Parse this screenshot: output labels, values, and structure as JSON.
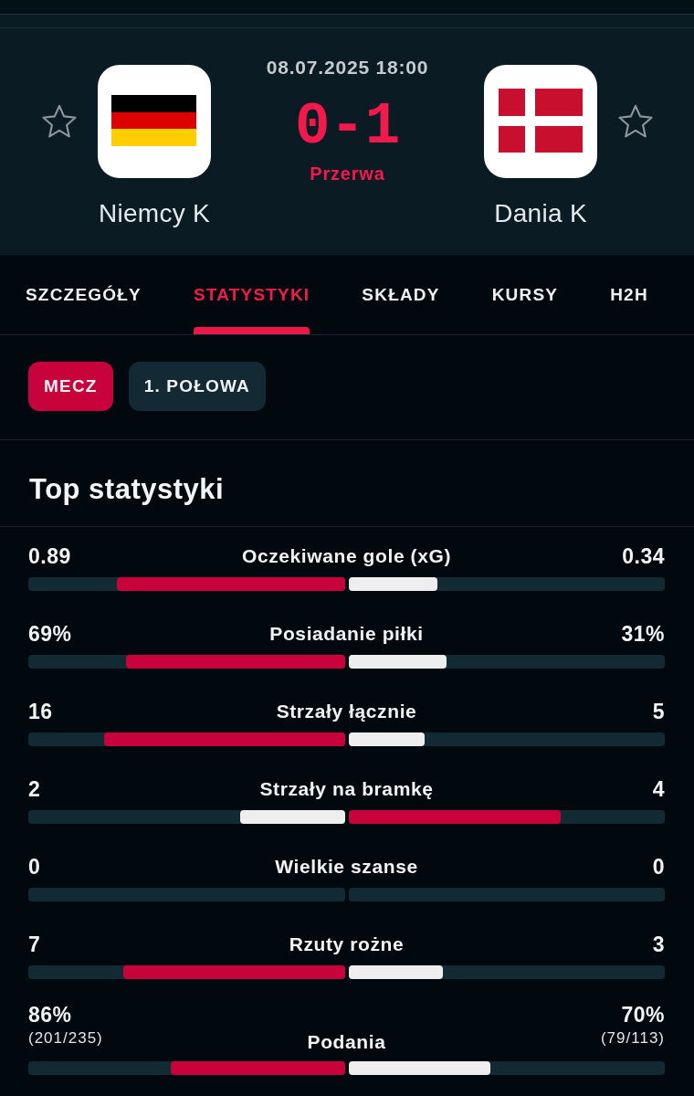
{
  "match": {
    "datetime": "08.07.2025 18:00",
    "score": "0-1",
    "status": "Przerwa",
    "teams": [
      {
        "name": "Niemcy K",
        "kind": "tricolor",
        "favorite": false
      },
      {
        "name": "Dania K",
        "kind": "cross",
        "favorite": false
      }
    ]
  },
  "tabs": [
    {
      "label": "SZCZEGÓŁY",
      "selected": false
    },
    {
      "label": "STATYSTYKI",
      "selected": true
    },
    {
      "label": "SKŁADY",
      "selected": false
    },
    {
      "label": "KURSY",
      "selected": false
    },
    {
      "label": "H2H",
      "selected": false
    }
  ],
  "periods": [
    {
      "label": "MECZ",
      "selected": true
    },
    {
      "label": "1. POŁOWA",
      "selected": false
    }
  ],
  "section": {
    "title": "Top statystyki"
  },
  "stats": [
    {
      "label": "Oczekiwane gole (xG)",
      "home": {
        "value": "0.89",
        "level": 0.72,
        "leading": true
      },
      "away": {
        "value": "0.34",
        "level": 0.28,
        "leading": false
      }
    },
    {
      "label": "Posiadanie piłki",
      "home": {
        "value": "69%",
        "level": 0.69,
        "leading": true
      },
      "away": {
        "value": "31%",
        "level": 0.31,
        "leading": false
      }
    },
    {
      "label": "Strzały łącznie",
      "home": {
        "value": "16",
        "level": 0.76,
        "leading": true
      },
      "away": {
        "value": "5",
        "level": 0.24,
        "leading": false
      }
    },
    {
      "label": "Strzały na bramkę",
      "home": {
        "value": "2",
        "level": 0.33,
        "leading": false
      },
      "away": {
        "value": "4",
        "level": 0.67,
        "leading": true
      }
    },
    {
      "label": "Wielkie szanse",
      "home": {
        "value": "0"
      },
      "away": {
        "value": "0"
      }
    },
    {
      "label": "Rzuty rożne",
      "home": {
        "value": "7",
        "level": 0.7,
        "leading": true
      },
      "away": {
        "value": "3",
        "level": 0.3,
        "leading": false
      }
    },
    {
      "label": "Podania",
      "home": {
        "value": "86%",
        "detail": "(201/235)",
        "level": 0.55,
        "leading": true
      },
      "away": {
        "value": "70%",
        "detail": "(79/113)",
        "level": 0.45,
        "leading": false
      }
    }
  ]
}
